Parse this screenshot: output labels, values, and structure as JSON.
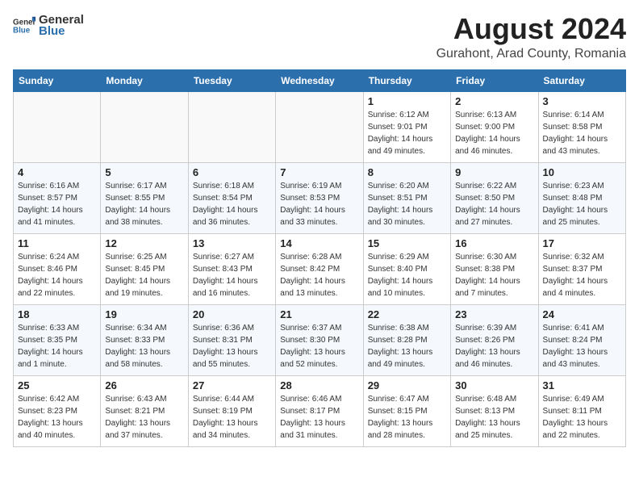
{
  "logo": {
    "general": "General",
    "blue": "Blue"
  },
  "title": {
    "month": "August 2024",
    "location": "Gurahont, Arad County, Romania"
  },
  "headers": [
    "Sunday",
    "Monday",
    "Tuesday",
    "Wednesday",
    "Thursday",
    "Friday",
    "Saturday"
  ],
  "weeks": [
    [
      {
        "day": "",
        "info": ""
      },
      {
        "day": "",
        "info": ""
      },
      {
        "day": "",
        "info": ""
      },
      {
        "day": "",
        "info": ""
      },
      {
        "day": "1",
        "info": "Sunrise: 6:12 AM\nSunset: 9:01 PM\nDaylight: 14 hours\nand 49 minutes."
      },
      {
        "day": "2",
        "info": "Sunrise: 6:13 AM\nSunset: 9:00 PM\nDaylight: 14 hours\nand 46 minutes."
      },
      {
        "day": "3",
        "info": "Sunrise: 6:14 AM\nSunset: 8:58 PM\nDaylight: 14 hours\nand 43 minutes."
      }
    ],
    [
      {
        "day": "4",
        "info": "Sunrise: 6:16 AM\nSunset: 8:57 PM\nDaylight: 14 hours\nand 41 minutes."
      },
      {
        "day": "5",
        "info": "Sunrise: 6:17 AM\nSunset: 8:55 PM\nDaylight: 14 hours\nand 38 minutes."
      },
      {
        "day": "6",
        "info": "Sunrise: 6:18 AM\nSunset: 8:54 PM\nDaylight: 14 hours\nand 36 minutes."
      },
      {
        "day": "7",
        "info": "Sunrise: 6:19 AM\nSunset: 8:53 PM\nDaylight: 14 hours\nand 33 minutes."
      },
      {
        "day": "8",
        "info": "Sunrise: 6:20 AM\nSunset: 8:51 PM\nDaylight: 14 hours\nand 30 minutes."
      },
      {
        "day": "9",
        "info": "Sunrise: 6:22 AM\nSunset: 8:50 PM\nDaylight: 14 hours\nand 27 minutes."
      },
      {
        "day": "10",
        "info": "Sunrise: 6:23 AM\nSunset: 8:48 PM\nDaylight: 14 hours\nand 25 minutes."
      }
    ],
    [
      {
        "day": "11",
        "info": "Sunrise: 6:24 AM\nSunset: 8:46 PM\nDaylight: 14 hours\nand 22 minutes."
      },
      {
        "day": "12",
        "info": "Sunrise: 6:25 AM\nSunset: 8:45 PM\nDaylight: 14 hours\nand 19 minutes."
      },
      {
        "day": "13",
        "info": "Sunrise: 6:27 AM\nSunset: 8:43 PM\nDaylight: 14 hours\nand 16 minutes."
      },
      {
        "day": "14",
        "info": "Sunrise: 6:28 AM\nSunset: 8:42 PM\nDaylight: 14 hours\nand 13 minutes."
      },
      {
        "day": "15",
        "info": "Sunrise: 6:29 AM\nSunset: 8:40 PM\nDaylight: 14 hours\nand 10 minutes."
      },
      {
        "day": "16",
        "info": "Sunrise: 6:30 AM\nSunset: 8:38 PM\nDaylight: 14 hours\nand 7 minutes."
      },
      {
        "day": "17",
        "info": "Sunrise: 6:32 AM\nSunset: 8:37 PM\nDaylight: 14 hours\nand 4 minutes."
      }
    ],
    [
      {
        "day": "18",
        "info": "Sunrise: 6:33 AM\nSunset: 8:35 PM\nDaylight: 14 hours\nand 1 minute."
      },
      {
        "day": "19",
        "info": "Sunrise: 6:34 AM\nSunset: 8:33 PM\nDaylight: 13 hours\nand 58 minutes."
      },
      {
        "day": "20",
        "info": "Sunrise: 6:36 AM\nSunset: 8:31 PM\nDaylight: 13 hours\nand 55 minutes."
      },
      {
        "day": "21",
        "info": "Sunrise: 6:37 AM\nSunset: 8:30 PM\nDaylight: 13 hours\nand 52 minutes."
      },
      {
        "day": "22",
        "info": "Sunrise: 6:38 AM\nSunset: 8:28 PM\nDaylight: 13 hours\nand 49 minutes."
      },
      {
        "day": "23",
        "info": "Sunrise: 6:39 AM\nSunset: 8:26 PM\nDaylight: 13 hours\nand 46 minutes."
      },
      {
        "day": "24",
        "info": "Sunrise: 6:41 AM\nSunset: 8:24 PM\nDaylight: 13 hours\nand 43 minutes."
      }
    ],
    [
      {
        "day": "25",
        "info": "Sunrise: 6:42 AM\nSunset: 8:23 PM\nDaylight: 13 hours\nand 40 minutes."
      },
      {
        "day": "26",
        "info": "Sunrise: 6:43 AM\nSunset: 8:21 PM\nDaylight: 13 hours\nand 37 minutes."
      },
      {
        "day": "27",
        "info": "Sunrise: 6:44 AM\nSunset: 8:19 PM\nDaylight: 13 hours\nand 34 minutes."
      },
      {
        "day": "28",
        "info": "Sunrise: 6:46 AM\nSunset: 8:17 PM\nDaylight: 13 hours\nand 31 minutes."
      },
      {
        "day": "29",
        "info": "Sunrise: 6:47 AM\nSunset: 8:15 PM\nDaylight: 13 hours\nand 28 minutes."
      },
      {
        "day": "30",
        "info": "Sunrise: 6:48 AM\nSunset: 8:13 PM\nDaylight: 13 hours\nand 25 minutes."
      },
      {
        "day": "31",
        "info": "Sunrise: 6:49 AM\nSunset: 8:11 PM\nDaylight: 13 hours\nand 22 minutes."
      }
    ]
  ]
}
